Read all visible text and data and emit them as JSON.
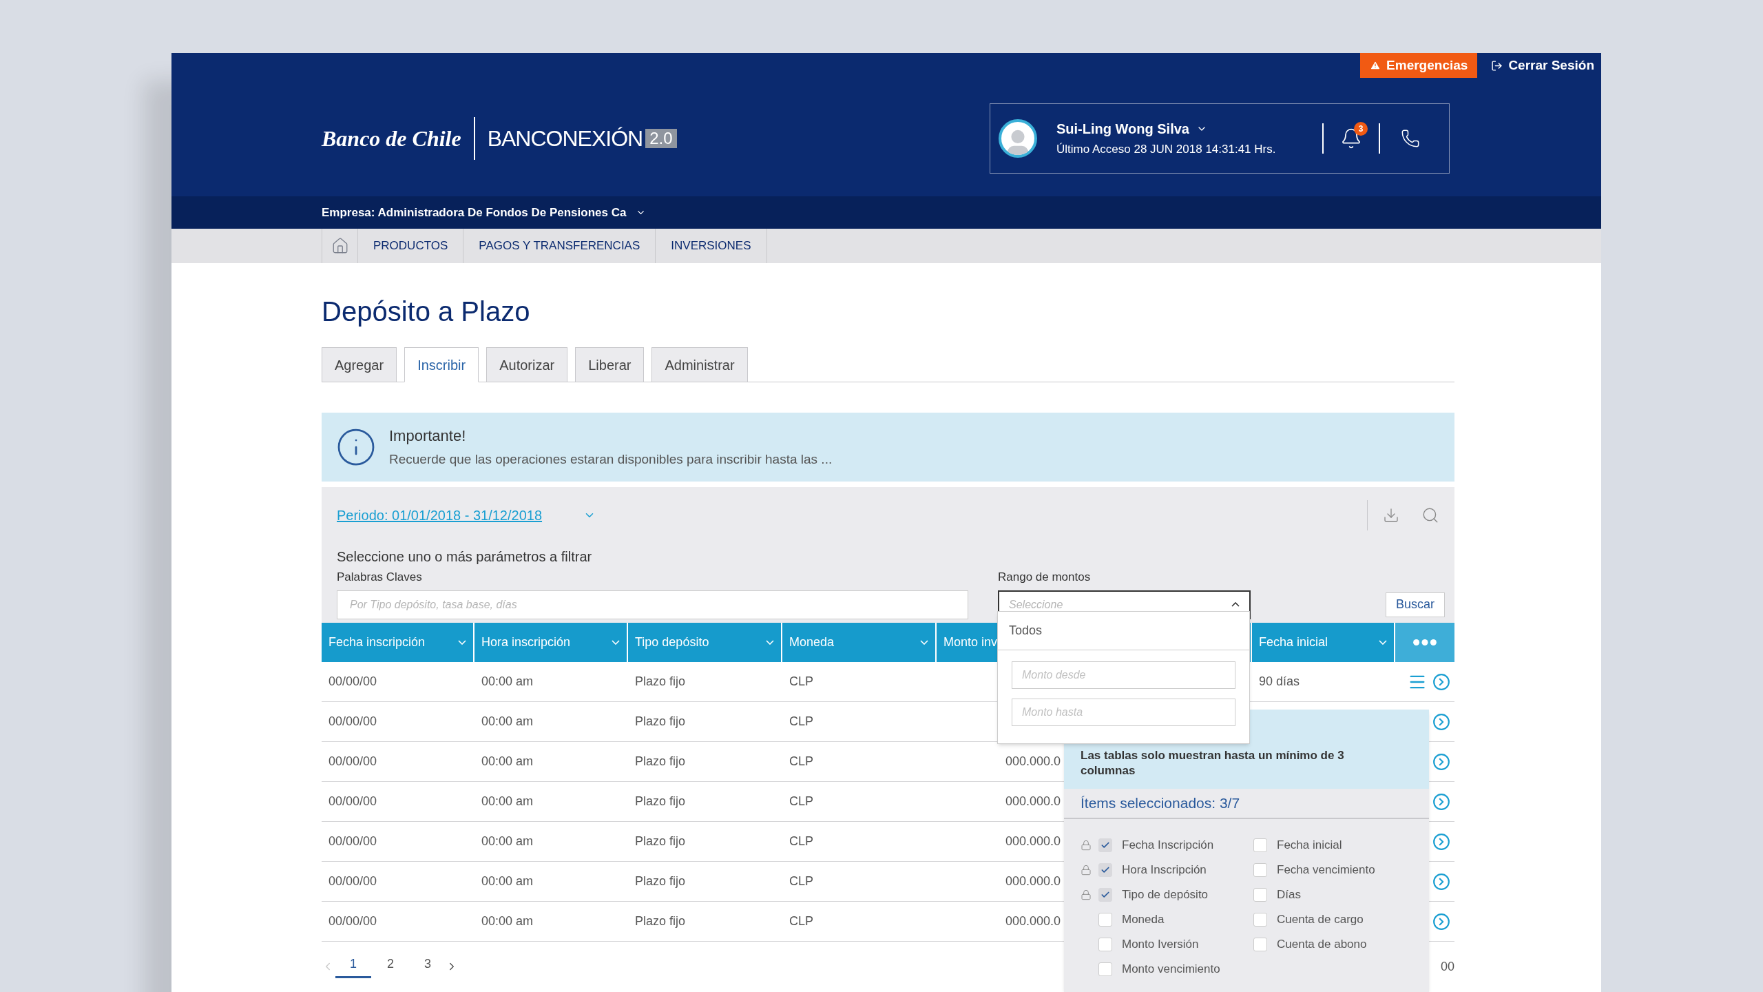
{
  "header": {
    "emergency_button": "Emergencias",
    "logout_link": "Cerrar Sesión",
    "bank_name": "Banco de Chile",
    "product_name": "BANCONEXIÓN",
    "version": "2.0",
    "user": {
      "name": "Sui-Ling Wong Silva",
      "last_access": "Último Acceso 28 JUN 2018 14:31:41 Hrs."
    },
    "notification_count": "3"
  },
  "company": "Empresa: Administradora De Fondos De Pensiones Ca",
  "nav": [
    "PRODUCTOS",
    "PAGOS Y TRANSFERENCIAS",
    "INVERSIONES"
  ],
  "page_title": "Depósito a Plazo",
  "tabs": [
    {
      "label": "Agregar",
      "selected": false
    },
    {
      "label": "Inscribir",
      "selected": true
    },
    {
      "label": "Autorizar",
      "selected": false
    },
    {
      "label": "Liberar",
      "selected": false
    },
    {
      "label": "Administrar",
      "selected": false
    }
  ],
  "notice": {
    "title": "Importante!",
    "text": "Recuerde que las operaciones estaran disponibles para inscribir hasta las ..."
  },
  "filter": {
    "period": "Periodo: 01/01/2018 - 31/12/2018",
    "prompt": "Seleccione uno o más parámetros a filtrar",
    "keywords_label": "Palabras Claves",
    "keywords_placeholder": "Por Tipo depósito, tasa base, días",
    "range_label": "Rango de montos",
    "range_placeholder": "Seleccione",
    "search_button": "Buscar"
  },
  "range_dropdown": {
    "expanded": true,
    "option": "Todos",
    "from_placeholder": "Monto desde",
    "to_placeholder": "Monto hasta"
  },
  "table": {
    "columns": [
      "Fecha inscripción",
      "Hora inscripción",
      "Tipo depósito",
      "Moneda",
      "Monto inv",
      "Fecha inicial"
    ],
    "rows": [
      {
        "fecha": "00/00/00",
        "hora": "00:00 am",
        "tipo": "Plazo fijo",
        "moneda": "CLP",
        "fecha_inicial": "90 días"
      },
      {
        "fecha": "00/00/00",
        "hora": "00:00 am",
        "tipo": "Plazo fijo",
        "moneda": "CLP"
      },
      {
        "fecha": "00/00/00",
        "hora": "00:00 am",
        "tipo": "Plazo fijo",
        "moneda": "CLP",
        "monto": "000.000.0"
      },
      {
        "fecha": "00/00/00",
        "hora": "00:00 am",
        "tipo": "Plazo fijo",
        "moneda": "CLP",
        "monto": "000.000.0"
      },
      {
        "fecha": "00/00/00",
        "hora": "00:00 am",
        "tipo": "Plazo fijo",
        "moneda": "CLP",
        "monto": "000.000.0"
      },
      {
        "fecha": "00/00/00",
        "hora": "00:00 am",
        "tipo": "Plazo fijo",
        "moneda": "CLP",
        "monto": "000.000.0"
      },
      {
        "fecha": "00/00/00",
        "hora": "00:00 am",
        "tipo": "Plazo fijo",
        "moneda": "CLP",
        "monto": "000.000.0"
      }
    ]
  },
  "column_panel": {
    "note": "Las tablas solo muestran hasta un mínimo de 3 columnas",
    "selected_count": "Ítems seleccionados: 3/7",
    "items": [
      {
        "label": "Fecha Inscripción",
        "checked": true,
        "locked": true
      },
      {
        "label": "Hora Inscripción",
        "checked": true,
        "locked": true
      },
      {
        "label": "Tipo de depósito",
        "checked": true,
        "locked": true
      },
      {
        "label": "Moneda",
        "checked": false,
        "locked": false
      },
      {
        "label": "Monto Iversión",
        "checked": false,
        "locked": false
      },
      {
        "label": "Monto vencimiento",
        "checked": false,
        "locked": false
      },
      {
        "label": "Fecha inicial",
        "checked": false,
        "locked": false
      },
      {
        "label": "Fecha vencimiento",
        "checked": false,
        "locked": false
      },
      {
        "label": "Días",
        "checked": false,
        "locked": false
      },
      {
        "label": "Cuenta de cargo",
        "checked": false,
        "locked": false
      },
      {
        "label": "Cuenta de abono",
        "checked": false,
        "locked": false
      }
    ]
  },
  "pagination": {
    "pages": [
      {
        "label": "1",
        "selected": true
      },
      {
        "label": "2",
        "selected": false
      },
      {
        "label": "3",
        "selected": false
      }
    ],
    "trailing_text": "00"
  }
}
